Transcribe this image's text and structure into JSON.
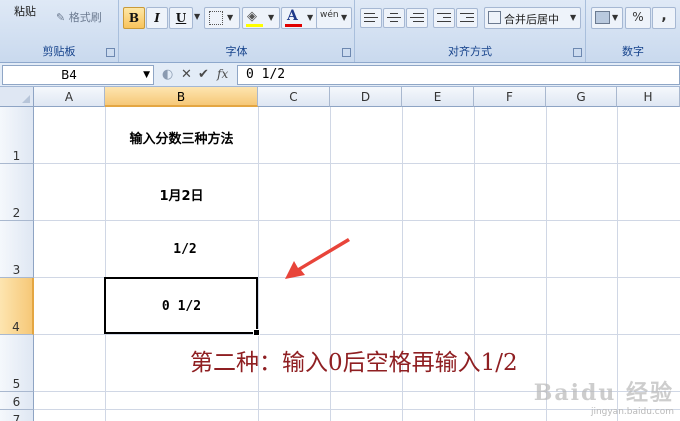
{
  "ribbon": {
    "clipboard": {
      "paste_label": "粘贴",
      "format_painter_label": "格式刷",
      "group_label": "剪贴板"
    },
    "font": {
      "bold": "B",
      "italic": "I",
      "underline": "U",
      "font_color_glyph": "A",
      "phonetic_glyph": "wén",
      "group_label": "字体"
    },
    "alignment": {
      "merge_center_label": "合并后居中",
      "group_label": "对齐方式"
    },
    "number": {
      "percent_label": "%",
      "comma_label": ",",
      "group_label": "数字"
    }
  },
  "formula_bar": {
    "name_box": "B4",
    "function_glyph": "fx",
    "content": "0 1/2"
  },
  "sheet": {
    "columns": [
      "A",
      "B",
      "C",
      "D",
      "E",
      "F",
      "G",
      "H"
    ],
    "rows": [
      "1",
      "2",
      "3",
      "4",
      "5",
      "6",
      "7"
    ],
    "selected_column": "B",
    "selected_row": "4",
    "cells": {
      "B1": "输入分数三种方法",
      "B2": "1月2日",
      "B3": "1/2",
      "B4": "0 1/2"
    }
  },
  "annotation": "第二种：输入0后空格再输入1/2",
  "watermark": {
    "logo": "Baidu 经验",
    "url": "jingyan.baidu.com"
  },
  "colors": {
    "accent_arrow": "#e8443a",
    "annotation_text": "#8f1f22",
    "header_selected": "#f6c878"
  }
}
